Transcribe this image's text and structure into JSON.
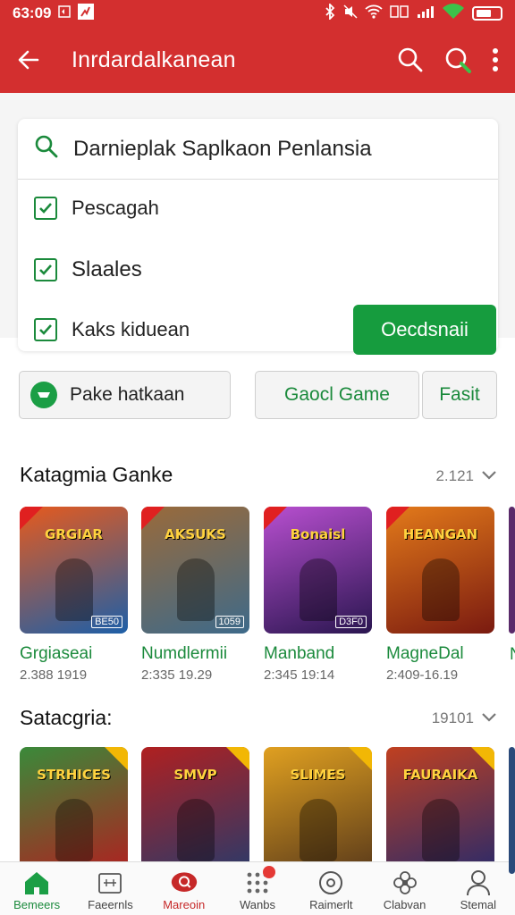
{
  "status": {
    "time": "63:09"
  },
  "appbar": {
    "title": "Inrdardalkanean"
  },
  "filter": {
    "search_text": "Darnieplak Saplkaon Penlansia",
    "options": [
      {
        "label": "Pescagah",
        "checked": true
      },
      {
        "label": "Slaales",
        "checked": true
      },
      {
        "label": "Kaks kiduean",
        "checked": true
      }
    ],
    "apply_label": "Oecdsnaii"
  },
  "quick_filters": {
    "primary": "Pake hatkaan",
    "secondary": "Gaocl Game",
    "tertiary": "Fasit"
  },
  "sections": [
    {
      "title": "Katagmia Ganke",
      "count": "2.121",
      "games": [
        {
          "name": "Grgiaseai",
          "sub": "2.388 1919",
          "art": "GRGIAR",
          "rating": "BE50",
          "colors": [
            "#e65a1d",
            "#1d5fa8"
          ]
        },
        {
          "name": "Numdlermii",
          "sub": "2:335 19.29",
          "art": "AKSUKS",
          "rating": "1059",
          "colors": [
            "#9a6a3a",
            "#3e6a8a"
          ]
        },
        {
          "name": "Manband",
          "sub": "2:345 19:14",
          "art": "Bonaisl",
          "rating": "D3F0",
          "colors": [
            "#b84fd0",
            "#2a1650"
          ]
        },
        {
          "name": "MagneDal",
          "sub": "2:409-16.19",
          "art": "HEANGAN",
          "rating": "",
          "colors": [
            "#e37a1a",
            "#7a1a10"
          ]
        }
      ],
      "partial_name": "N"
    },
    {
      "title": "Satacgria:",
      "count": "19101",
      "games": [
        {
          "art": "STRHICES",
          "colors": [
            "#3a8a3a",
            "#b02020"
          ]
        },
        {
          "art": "SMVP",
          "colors": [
            "#b02020",
            "#2a3a6a"
          ]
        },
        {
          "art": "SLIMES",
          "colors": [
            "#e0a020",
            "#5a3a1a"
          ]
        },
        {
          "art": "FAURAIKA",
          "colors": [
            "#c04020",
            "#2a2a6a"
          ]
        }
      ]
    }
  ],
  "nav": [
    {
      "label": "Bemeers"
    },
    {
      "label": "Faeernls"
    },
    {
      "label": "Mareoin"
    },
    {
      "label": "Wanbs"
    },
    {
      "label": "Raimerlt"
    },
    {
      "label": "Clabvan"
    },
    {
      "label": "Stemal"
    }
  ],
  "colors": {
    "brand_red": "#d32f2f",
    "accent_green": "#169c3e"
  }
}
